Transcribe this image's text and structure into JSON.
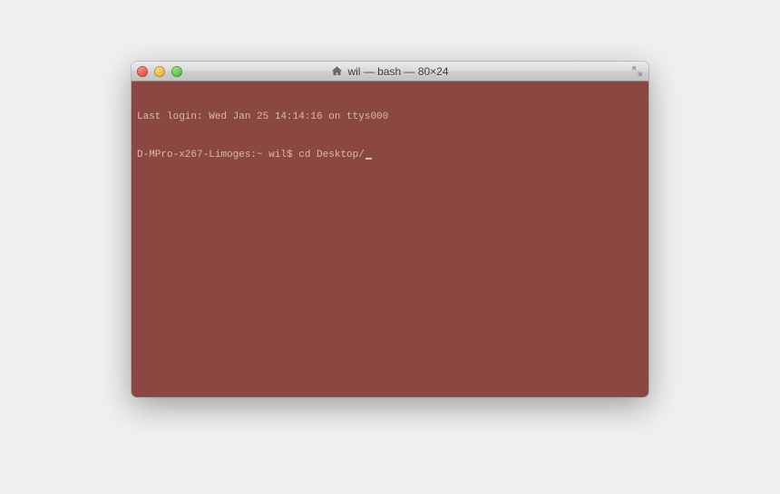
{
  "window": {
    "title": "wil — bash — 80×24"
  },
  "terminal": {
    "last_login": "Last login: Wed Jan 25 14:14:16 on ttys000",
    "prompt": "D-MPro-x267-Limoges:~ wil$ ",
    "command": "cd Desktop/"
  },
  "colors": {
    "terminal_bg": "#8b4843",
    "terminal_fg": "#d7baa8"
  }
}
